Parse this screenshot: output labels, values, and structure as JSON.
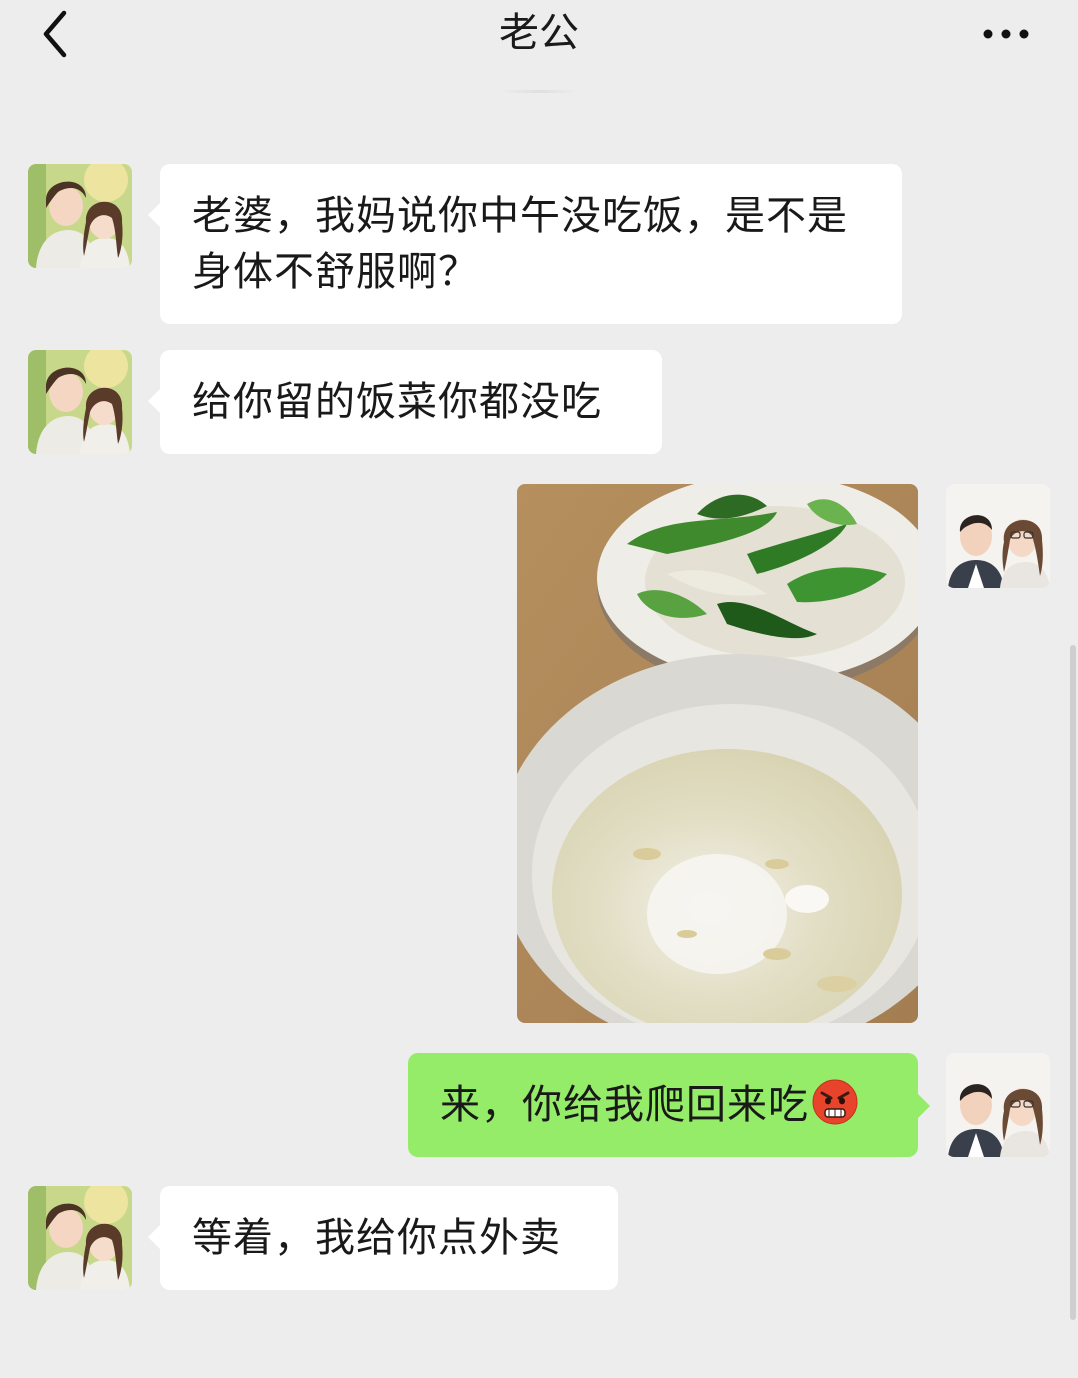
{
  "header": {
    "title": "老公",
    "back_icon": "chevron-left-icon",
    "more_icon": "more-dots-icon"
  },
  "messages": [
    {
      "side": "left",
      "type": "text",
      "text": "老婆，我妈说你中午没吃饭，是不是身体不舒服啊？"
    },
    {
      "side": "left",
      "type": "text",
      "text": "给你留的饭菜你都没吃"
    },
    {
      "side": "right",
      "type": "image",
      "content": "photo of leftover food in two bowls"
    },
    {
      "side": "right",
      "type": "text",
      "text": "来，你给我爬回来吃",
      "emoji": "angry-face-icon"
    },
    {
      "side": "left",
      "type": "text",
      "text": "等着，我给你点外卖"
    }
  ],
  "colors": {
    "background": "#EDEDED",
    "left_bubble": "#FFFFFF",
    "right_bubble": "#95EC69",
    "text": "#191919"
  }
}
